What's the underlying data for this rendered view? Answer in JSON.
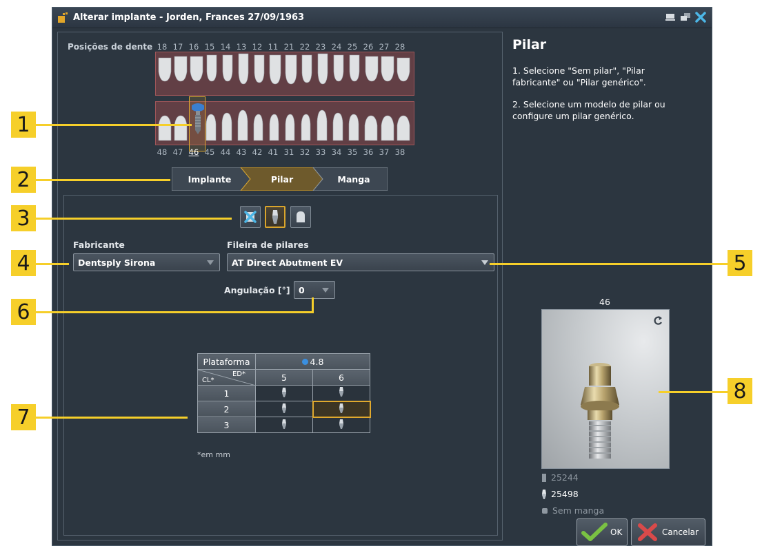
{
  "window": {
    "title": "Alterar implante - Jorden, Frances 27/09/1963"
  },
  "teeth": {
    "label": "Posições de dente",
    "upper": [
      "18",
      "17",
      "16",
      "15",
      "14",
      "13",
      "12",
      "11",
      "21",
      "22",
      "23",
      "24",
      "25",
      "26",
      "27",
      "28"
    ],
    "lower": [
      "48",
      "47",
      "46",
      "45",
      "44",
      "43",
      "42",
      "41",
      "31",
      "32",
      "33",
      "34",
      "35",
      "36",
      "37",
      "38"
    ],
    "selected": "46"
  },
  "wizard": {
    "steps": [
      "Implante",
      "Pilar",
      "Manga"
    ],
    "active": "Pilar"
  },
  "toolbar": {
    "types": [
      "no-abutment",
      "manufacturer-abutment",
      "generic-abutment"
    ],
    "active": "manufacturer-abutment"
  },
  "form": {
    "manufacturer_label": "Fabricante",
    "manufacturer_value": "Dentsply Sirona",
    "series_label": "Fileira de pilares",
    "series_value": "AT Direct Abutment EV",
    "angulation_label": "Angulação [°]",
    "angulation_value": "0"
  },
  "grid": {
    "platform_label": "Plataforma",
    "platform_value": "4.8",
    "ed_label": "ED*",
    "cl_label": "CL*",
    "columns": [
      "5",
      "6"
    ],
    "rows": [
      "1",
      "2",
      "3"
    ],
    "selected": {
      "row": "2",
      "col": "6"
    },
    "note": "*em mm"
  },
  "sidebar": {
    "title": "Pilar",
    "instruction_1": "1. Selecione \"Sem pilar\", \"Pilar fabricante\" ou \"Pilar genérico\".",
    "instruction_2": "2. Selecione um modelo de pilar ou configure um pilar genérico.",
    "preview_label": "46",
    "implant_id": "25244",
    "abutment_id": "25498",
    "sleeve_text": "Sem manga"
  },
  "buttons": {
    "ok": "OK",
    "cancel": "Cancelar"
  },
  "callouts": [
    "1",
    "2",
    "3",
    "4",
    "5",
    "6",
    "7",
    "8"
  ],
  "colors": {
    "accent": "#f6cf2a",
    "selection": "#e0a92e",
    "background": "#2c3640"
  }
}
